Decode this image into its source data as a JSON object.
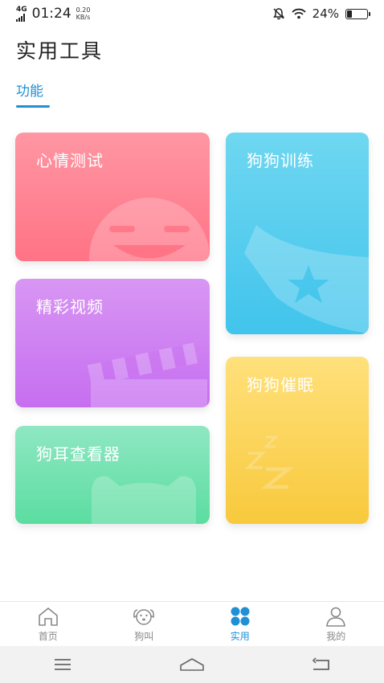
{
  "status_bar": {
    "network": "4G",
    "time": "01:24",
    "speed_value": "0.20",
    "speed_unit": "KB/s",
    "battery": "24%",
    "battery_level": 0.24
  },
  "header": {
    "title": "实用工具"
  },
  "tabs": [
    {
      "label": "功能",
      "active": true
    }
  ],
  "cards": {
    "mood": {
      "label": "心情测试",
      "icon": "smiley-face-icon",
      "color": "#ff7d8d"
    },
    "video": {
      "label": "精彩视频",
      "icon": "clapperboard-icon",
      "color": "#cf7ff2"
    },
    "ear": {
      "label": "狗耳查看器",
      "icon": "dog-head-icon",
      "color": "#6ee1ad"
    },
    "train": {
      "label": "狗狗训练",
      "icon": "flag-star-icon",
      "color": "#52cbed"
    },
    "sleep": {
      "label": "狗狗催眠",
      "icon": "moon-zzz-icon",
      "color": "#f9d254"
    }
  },
  "bottom_nav": [
    {
      "label": "首页",
      "icon": "home-icon",
      "active": false
    },
    {
      "label": "狗叫",
      "icon": "dog-face-icon",
      "active": false
    },
    {
      "label": "实用",
      "icon": "grid-icon",
      "active": true
    },
    {
      "label": "我的",
      "icon": "user-icon",
      "active": false
    }
  ],
  "system_nav": [
    "menu-icon",
    "home-outline-icon",
    "back-icon"
  ]
}
